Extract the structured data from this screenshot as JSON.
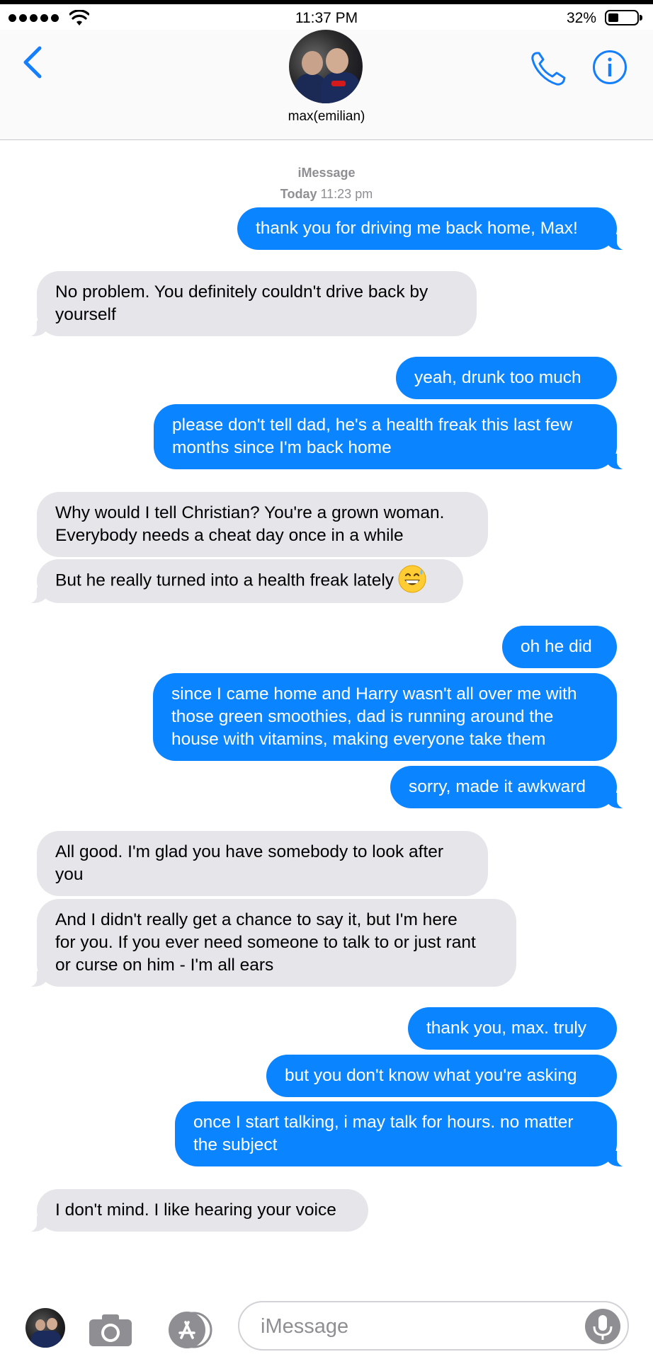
{
  "status_bar": {
    "time": "11:37 PM",
    "battery_percent": "32%",
    "battery_level": 0.32,
    "signal_bars": 5
  },
  "header": {
    "contact_name": "max(emilian)"
  },
  "thread_meta": {
    "service": "iMessage",
    "day": "Today",
    "time": "11:23 pm"
  },
  "messages": [
    {
      "side": "outgoing",
      "text": "thank you for driving me back home, Max!"
    },
    {
      "side": "incoming",
      "lines": [
        "No problem. You definitely couldn't drive back by",
        "yourself"
      ]
    },
    {
      "side": "outgoing",
      "text": "yeah, drunk too much"
    },
    {
      "side": "outgoing",
      "lines": [
        "please don't tell dad, he's a health freak this last few",
        "months since I'm back home"
      ]
    },
    {
      "side": "incoming",
      "lines": [
        "Why would I tell Christian? You're a grown woman.",
        "Everybody needs a cheat day once in a while"
      ]
    },
    {
      "side": "incoming",
      "text": "But he really turned into a health freak lately",
      "emoji": "grinning-sweat-emoji"
    },
    {
      "side": "outgoing",
      "text": "oh he did"
    },
    {
      "side": "outgoing",
      "lines": [
        "since I came home and Harry wasn't all over me with",
        "those green smoothies, dad is running around the",
        "house with vitamins, making everyone take them"
      ]
    },
    {
      "side": "outgoing",
      "text": "sorry, made it awkward"
    },
    {
      "side": "incoming",
      "lines": [
        "All good. I'm glad you have somebody to look after",
        "you"
      ]
    },
    {
      "side": "incoming",
      "lines": [
        "And I didn't really get a chance to say it, but I'm here",
        "for you. If you ever need someone to talk to or just rant",
        "or curse on him - I'm all ears"
      ]
    },
    {
      "side": "outgoing",
      "text": "thank you, max. truly"
    },
    {
      "side": "outgoing",
      "text": "but you don't know what you're asking"
    },
    {
      "side": "outgoing",
      "lines": [
        "once I start talking, i may talk for hours. no matter",
        "the subject"
      ]
    },
    {
      "side": "incoming",
      "text": "I don't mind. I like hearing your voice"
    }
  ],
  "input_bar": {
    "placeholder": "iMessage"
  },
  "colors": {
    "accent": "#0b84ff",
    "incoming_bubble": "#e5e5ea",
    "meta_text": "#8e8e93",
    "icon_blue": "#147efb"
  }
}
